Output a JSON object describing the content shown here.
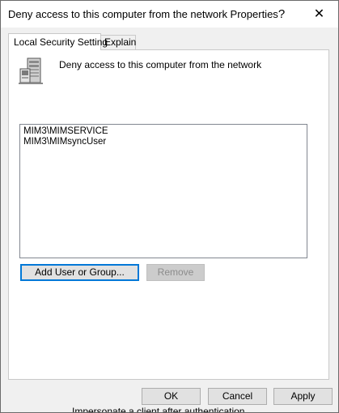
{
  "window": {
    "title": "Deny access to this computer from the network Properties",
    "help_label": "?",
    "close_label": "✕"
  },
  "tabs": [
    {
      "label": "Local Security Setting",
      "active": true
    },
    {
      "label": "Explain",
      "active": false
    }
  ],
  "policy": {
    "icon": "server-icon",
    "name": "Deny access to this computer from the network"
  },
  "members": [
    "MIM3\\MIMSERVICE",
    "MIM3\\MIMsyncUser"
  ],
  "buttons": {
    "add": "Add User or Group...",
    "remove": "Remove",
    "ok": "OK",
    "cancel": "Cancel",
    "apply": "Apply"
  },
  "background_text": "Impersonate a client after authentication"
}
